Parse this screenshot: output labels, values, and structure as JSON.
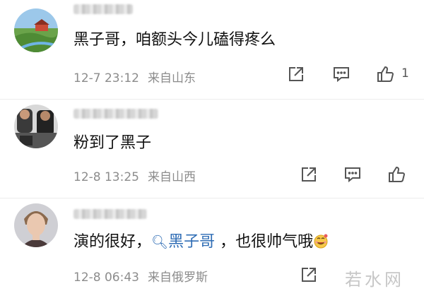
{
  "comments": [
    {
      "text": "黑子哥，咱额头今儿磕得疼么",
      "date": "12-7 23:12",
      "location": "来自山东",
      "likes": "1",
      "avatar": "landscape-avatar"
    },
    {
      "text": "粉到了黑子",
      "date": "12-8 13:25",
      "location": "来自山西",
      "avatar": "group-photo-avatar"
    },
    {
      "text_before": "演的很好，",
      "search_query": "黑子哥",
      "text_after": " ，也很帅气哦",
      "date": "12-8 06:43",
      "location": "来自俄罗斯",
      "avatar": "portrait-avatar"
    }
  ],
  "watermark": "若水网",
  "colors": {
    "link": "#2f6db5",
    "meta": "#8c8c8c",
    "text": "#111111"
  }
}
